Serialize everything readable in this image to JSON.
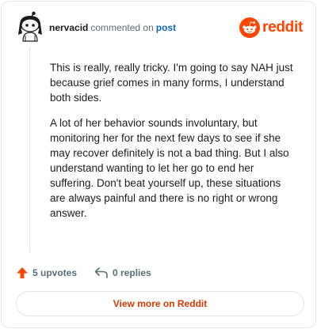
{
  "header": {
    "username": "nervacid",
    "action_text": "commented on",
    "post_link": "post",
    "brand": "reddit"
  },
  "comment": {
    "paragraphs": [
      "This is really, really tricky. I'm going to say NAH just because grief comes in many forms, I understand both sides.",
      "A lot of her behavior sounds involuntary, but monitoring her for the next few days to see if she may recover definitely is not a bad thing. But I also understand wanting to let her go to end her suffering. Don't beat yourself up, these situations are always painful and there is no right or wrong answer."
    ]
  },
  "actions": {
    "upvotes": "5 upvotes",
    "replies": "0 replies"
  },
  "footer": {
    "view_more": "View more on Reddit"
  },
  "colors": {
    "brand": "#ff4500",
    "link": "#0a66c2",
    "cta": "#d93900",
    "muted": "#576f76"
  },
  "icons": [
    "avatar-snoo-icon",
    "reddit-logo-icon",
    "upvote-arrow-icon",
    "reply-arrow-icon"
  ]
}
